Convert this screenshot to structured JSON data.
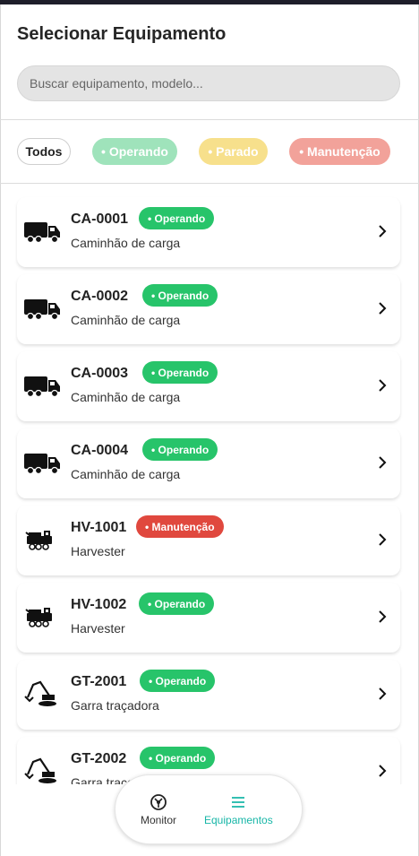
{
  "header": {
    "title": "Selecionar Equipamento"
  },
  "search": {
    "placeholder": "Buscar equipamento, modelo..."
  },
  "filters": [
    {
      "label": "Todos"
    },
    {
      "label": "• Operando"
    },
    {
      "label": "• Parado"
    },
    {
      "label": "• Manutenção"
    }
  ],
  "equipment": [
    {
      "code": "CA-0001",
      "type": "Caminhão de carga",
      "status": "• Operando",
      "icon": "truck-icon"
    },
    {
      "code": "CA-0002",
      "type": "Caminhão de carga",
      "status": "• Operando",
      "icon": "truck-icon"
    },
    {
      "code": "CA-0003",
      "type": "Caminhão de carga",
      "status": "• Operando",
      "icon": "truck-icon"
    },
    {
      "code": "CA-0004",
      "type": "Caminhão de carga",
      "status": "• Operando",
      "icon": "truck-icon"
    },
    {
      "code": "HV-1001",
      "type": "Harvester",
      "status": "• Manutenção",
      "icon": "harvester-icon"
    },
    {
      "code": "HV-1002",
      "type": "Harvester",
      "status": "• Operando",
      "icon": "harvester-icon"
    },
    {
      "code": "GT-2001",
      "type": "Garra traçadora",
      "status": "• Operando",
      "icon": "excavator-icon"
    },
    {
      "code": "GT-2002",
      "type": "Garra traçadora",
      "status": "• Operando",
      "icon": "excavator-icon"
    }
  ],
  "nav": {
    "monitor": "Monitor",
    "equipamentos": "Equipamentos"
  },
  "colors": {
    "operando": "#27c46a",
    "manutencao": "#e0483e",
    "parado": "#f7e08c",
    "accent": "#17b6a7"
  }
}
